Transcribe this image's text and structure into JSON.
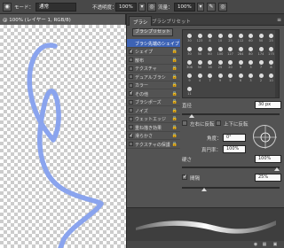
{
  "options_bar": {
    "mode_label": "モード：",
    "mode_value": "通常",
    "opacity_label": "不透明度：",
    "opacity_value": "100%",
    "flow_label": "流量：",
    "flow_value": "100%"
  },
  "document": {
    "tab_title": "@ 100% (レイヤー 1, RGB/8)"
  },
  "panel": {
    "tabs": [
      {
        "label": "ブラシ",
        "active": true
      },
      {
        "label": "ブラシプリセット",
        "active": false
      }
    ],
    "preset_button": "ブラシプリセット",
    "settings": [
      {
        "label": "ブラシ先端のシェイプ",
        "checked": false,
        "header": true
      },
      {
        "label": "シェイプ",
        "checked": true
      },
      {
        "label": "散布",
        "checked": false
      },
      {
        "label": "テクスチャ",
        "checked": false
      },
      {
        "label": "デュアルブラシ",
        "checked": false
      },
      {
        "label": "カラー",
        "checked": false
      },
      {
        "label": "その他",
        "checked": true
      },
      {
        "label": "ブラシポーズ",
        "checked": false
      },
      {
        "label": "ノイズ",
        "checked": false
      },
      {
        "label": "ウェットエッジ",
        "checked": false
      },
      {
        "label": "重ね描き効果",
        "checked": false
      },
      {
        "label": "滑らかさ",
        "checked": true
      },
      {
        "label": "テクスチャの保護",
        "checked": false
      }
    ],
    "brush_tip_sizes": [
      "30",
      "123",
      "8",
      "10",
      "25",
      "112",
      "60",
      "50",
      "25",
      "30",
      "50",
      "60",
      "100",
      "127",
      "284",
      "80",
      "174",
      "175",
      "306",
      "50",
      "16",
      "25",
      "20",
      "9",
      "3",
      "7",
      "8",
      "9",
      "4",
      "7",
      "9",
      "5",
      "6",
      "3",
      "2",
      "10",
      "11"
    ],
    "size_label": "直径",
    "size_value": "30 px",
    "flip_x_label": "左右に反転",
    "flip_y_label": "上下に反転",
    "angle_label": "角度：",
    "angle_value": "0°",
    "roundness_label": "真円率：",
    "roundness_value": "100%",
    "hardness_label": "硬さ",
    "hardness_value": "100%",
    "spacing_label": "間隔",
    "spacing_value": "25%",
    "spacing_checked": true
  },
  "stroke_color": "#8aa4ee"
}
